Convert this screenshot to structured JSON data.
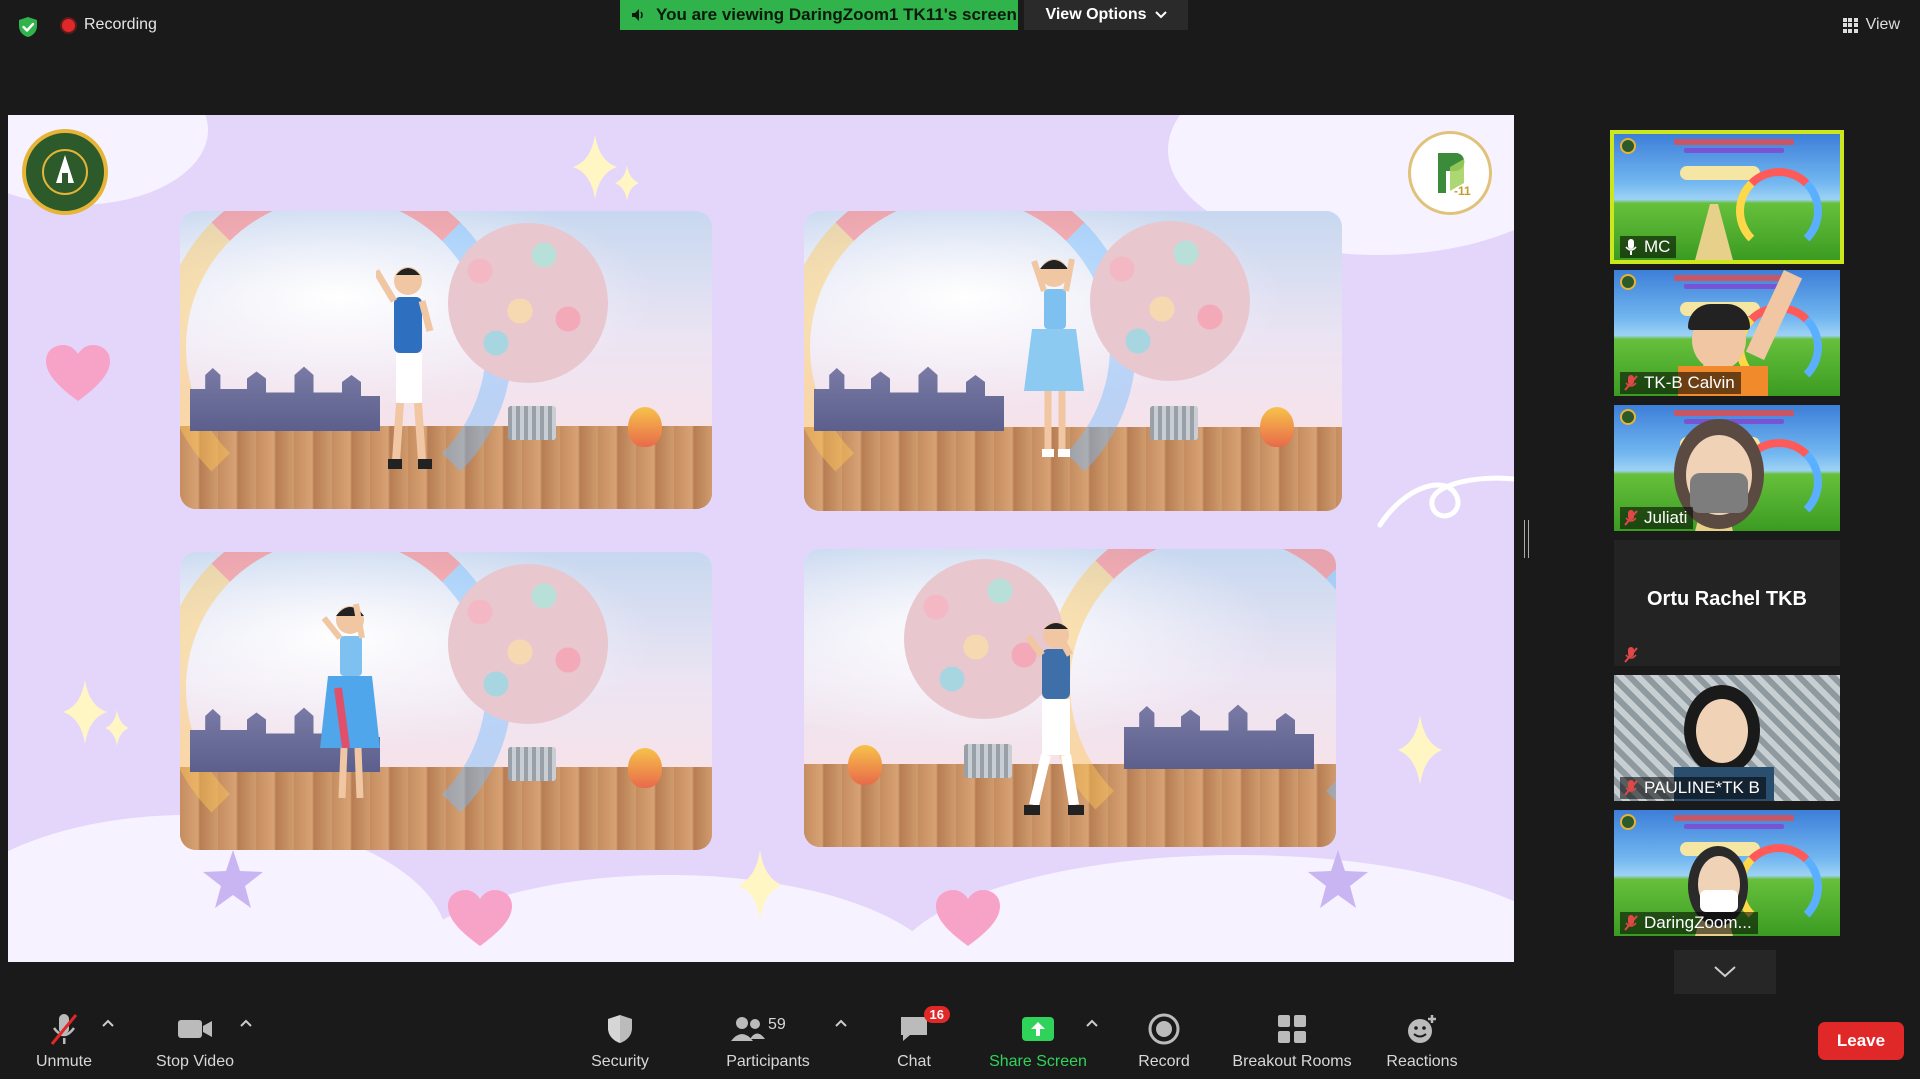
{
  "topbar": {
    "recording_label": "Recording",
    "viewing_banner": "You are viewing DaringZoom1 TK11's screen",
    "view_options_label": "View Options",
    "view_label": "View"
  },
  "participants": [
    {
      "name": "MC",
      "active_speaker": true,
      "muted": false
    },
    {
      "name": "TK-B Calvin",
      "muted": true
    },
    {
      "name": "Juliati",
      "muted": true
    },
    {
      "name": "Ortu Rachel TKB",
      "muted": true,
      "video_off": true
    },
    {
      "name": "PAULINE*TK B",
      "muted": true
    },
    {
      "name": "DaringZoom...",
      "muted": true
    }
  ],
  "toolbar": {
    "unmute": "Unmute",
    "stop_video": "Stop Video",
    "security": "Security",
    "participants": "Participants",
    "participants_count": "59",
    "chat": "Chat",
    "chat_badge": "16",
    "share_screen": "Share Screen",
    "record": "Record",
    "breakout_rooms": "Breakout Rooms",
    "reactions": "Reactions",
    "leave": "Leave"
  },
  "colors": {
    "banner_green": "#2fb34a",
    "leave_red": "#e02828",
    "active_speaker_border": "#cce81c",
    "share_screen_green": "#2fd35a",
    "slide_background": "#e4d6fb"
  },
  "icons": [
    "shield-check-icon",
    "recording-dot-icon",
    "speaker-icon",
    "chevron-down-icon",
    "grid-icon",
    "muted-mic-icon",
    "video-camera-icon",
    "security-shield-icon",
    "participants-icon",
    "chat-bubble-icon",
    "share-screen-arrow-icon",
    "record-icon",
    "breakout-rooms-icon",
    "reactions-icon"
  ]
}
